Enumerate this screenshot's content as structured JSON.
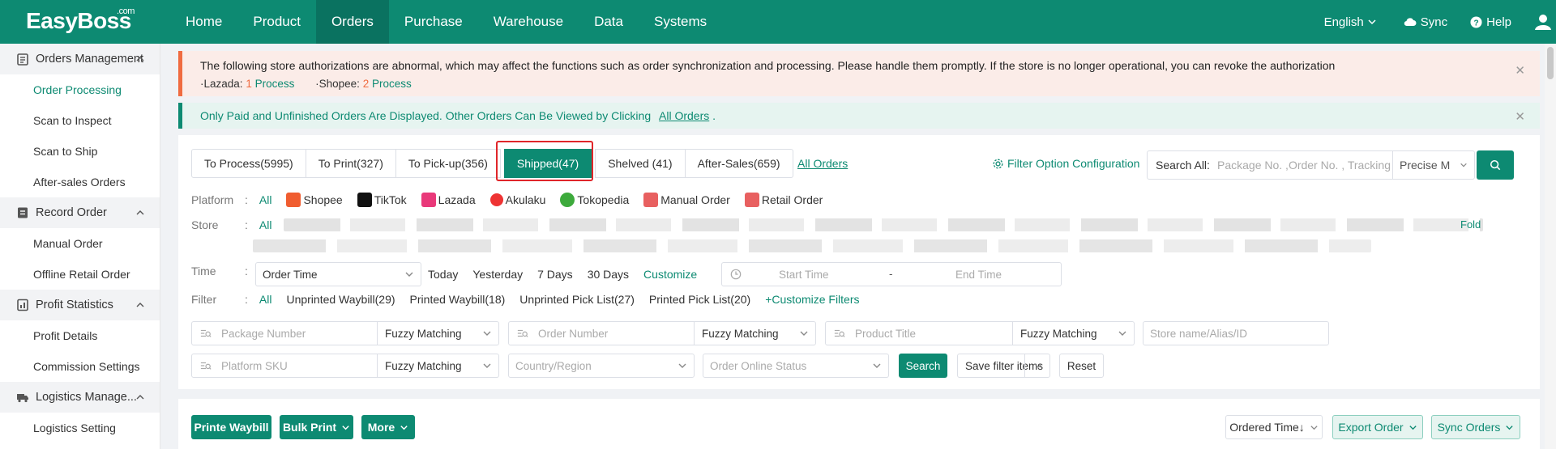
{
  "app": {
    "logo": "EasyBoss",
    "logo_sup": ".com"
  },
  "nav": [
    "Home",
    "Product",
    "Orders",
    "Purchase",
    "Warehouse",
    "Data",
    "Systems"
  ],
  "nav_active": "Orders",
  "top_right": {
    "language": "English",
    "sync": "Sync",
    "help": "Help"
  },
  "sidebar": {
    "groups": [
      {
        "label": "Orders Management",
        "icon": "clipboard-icon",
        "items": [
          "Order Processing",
          "Scan to Inspect",
          "Scan to Ship",
          "After-sales Orders"
        ]
      },
      {
        "label": "Record Order",
        "icon": "document-icon",
        "items": [
          "Manual Order",
          "Offline Retail Order"
        ]
      },
      {
        "label": "Profit Statistics",
        "icon": "chart-icon",
        "items": [
          "Profit Details",
          "Commission Settings"
        ]
      },
      {
        "label": "Logistics Manage...",
        "icon": "truck-icon",
        "items": [
          "Logistics Setting"
        ]
      }
    ],
    "active_item": "Order Processing"
  },
  "alert_auth": {
    "text": "The following store authorizations are abnormal, which may affect the functions such as order synchronization and processing. Please handle them promptly. If the store is no longer operational, you can revoke the authorization",
    "lazada_label": "·Lazada:",
    "lazada_count": "1",
    "shopee_label": "·Shopee:",
    "shopee_count": "2",
    "process": "Process"
  },
  "alert_info": {
    "text": "Only Paid and Unfinished Orders Are Displayed. Other Orders Can Be Viewed by Clicking",
    "link": "All Orders",
    "tail": "."
  },
  "tabs": [
    "To Process(5995)",
    "To Print(327)",
    "To Pick-up(356)",
    "Shipped(47)",
    "Shelved (41)",
    "After-Sales(659)"
  ],
  "tab_active": "Shipped(47)",
  "all_orders_link": "All Orders",
  "filter_config": "Filter Option Configuration",
  "search_all": {
    "label": "Search All:",
    "placeholder": "Package No. ,Order No. , Tracking",
    "mode": "Precise M"
  },
  "platform": {
    "label": "Platform",
    "all": "All",
    "options": [
      "Shopee",
      "TikTok",
      "Lazada",
      "Akulaku",
      "Tokopedia",
      "Manual Order",
      "Retail Order"
    ]
  },
  "store": {
    "label": "Store",
    "all": "All",
    "fold": "Fold"
  },
  "time": {
    "label": "Time",
    "field": "Order Time",
    "options": [
      "Today",
      "Yesterday",
      "7 Days",
      "30 Days"
    ],
    "customize": "Customize",
    "start": "Start Time",
    "sep": "-",
    "end": "End Time"
  },
  "filter": {
    "label": "Filter",
    "all": "All",
    "options": [
      "Unprinted Waybill(29)",
      "Printed Waybill(18)",
      "Unprinted Pick List(27)",
      "Printed Pick List(20)"
    ],
    "customize": "+Customize Filters"
  },
  "search_fields": {
    "package_number": "Package Number",
    "order_number": "Order Number",
    "product_title": "Product Title",
    "store_name": "Store name/Alias/ID",
    "platform_sku": "Platform SKU",
    "fuzzy": "Fuzzy Matching",
    "country": "Country/Region",
    "online_status": "Order Online Status",
    "search": "Search",
    "save_filter": "Save filter items",
    "reset": "Reset"
  },
  "actions": {
    "print_waybill": "Printe Waybill",
    "bulk_print": "Bulk Print",
    "more": "More",
    "sort": "Ordered Time↓",
    "export": "Export Order",
    "sync_orders": "Sync Orders"
  },
  "colors": {
    "primary": "#0d8a72",
    "warning": "#f06b40",
    "highlight": "#e0262a"
  }
}
